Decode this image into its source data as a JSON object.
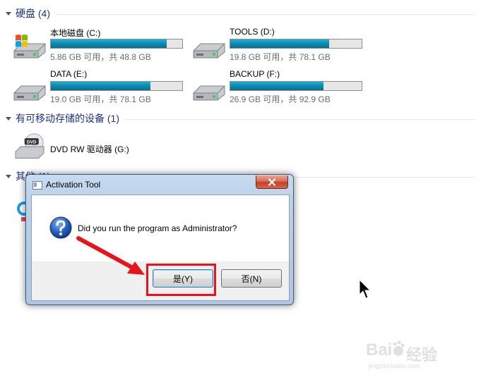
{
  "groups": {
    "hard_disks": {
      "title": "硬盘 (4)"
    },
    "removable": {
      "title": "有可移动存储的设备 (1)"
    },
    "others": {
      "title": "其他 (1)"
    }
  },
  "drives": [
    {
      "name": "本地磁盘 (C:)",
      "info": "5.86 GB 可用，共 48.8 GB",
      "used_fraction": 0.88
    },
    {
      "name": "TOOLS (D:)",
      "info": "19.8 GB 可用，共 78.1 GB",
      "used_fraction": 0.75
    },
    {
      "name": "DATA (E:)",
      "info": "19.0 GB 可用，共 78.1 GB",
      "used_fraction": 0.76
    },
    {
      "name": "BACKUP (F:)",
      "info": "26.9 GB 可用，共 92.9 GB",
      "used_fraction": 0.71
    }
  ],
  "removable_drive": {
    "name": "DVD RW 驱动器 (G:)",
    "icon_label": "DVD"
  },
  "dialog": {
    "title": "Activation Tool",
    "message": "Did you run the program as Administrator?",
    "yes_label": "是(Y)",
    "no_label": "否(N)"
  },
  "watermark": {
    "text": "经验",
    "brand": "Bai",
    "url": "jingyan.baidu.com"
  },
  "colors": {
    "accent_title": "#1e3287",
    "bar_fill": "#0f8cb4",
    "highlight": "#e8141b"
  }
}
